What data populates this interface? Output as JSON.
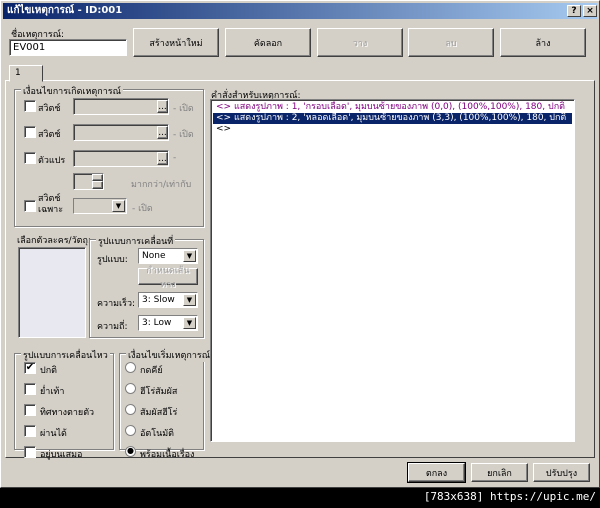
{
  "window": {
    "title": "แก้ไขเหตุการณ์ - ID:001",
    "help": "?",
    "close": "×"
  },
  "event_name": {
    "label": "ชื่อเหตุการณ์:",
    "value": "EV001"
  },
  "toolbar": {
    "new_page": "สร้างหน้าใหม่",
    "copy": "คัดลอก",
    "paste": "วาง",
    "delete": "ลบ",
    "clear": "ล้าง"
  },
  "tabs": [
    "1"
  ],
  "conditions": {
    "title": "เงื่อนไขการเกิดเหตุการณ์",
    "switch1": "สวิตช์",
    "switch2": "สวิตช์",
    "variable": "ตัวแปร",
    "self_switch": "สวิตช์ เฉพาะ",
    "on": "- เปิด",
    "dash": "-",
    "gte": "มากกว่า/เท่ากับ",
    "browse": "..."
  },
  "graphic": {
    "label": "เลือกตัวละคร/วัตถุ:"
  },
  "movement": {
    "title": "รูปแบบการเคลื่อนที่",
    "type_label": "รูปแบบ:",
    "type": "None",
    "route": "กำหนดเส้นทาง",
    "speed_label": "ความเร็ว:",
    "speed": "3: Slow",
    "freq_label": "ความถี่:",
    "freq": "3: Low"
  },
  "options": {
    "title": "รูปแบบการเคลื่อนไหว",
    "items": [
      {
        "label": "ปกติ",
        "checked": true
      },
      {
        "label": "ย่ำเท้า",
        "checked": false
      },
      {
        "label": "ทิศทางตายตัว",
        "checked": false
      },
      {
        "label": "ผ่านได้",
        "checked": false
      },
      {
        "label": "อยู่บนเสมอ",
        "checked": false
      }
    ]
  },
  "trigger": {
    "title": "เงื่อนไขเริ่มเหตุการณ์",
    "items": [
      {
        "label": "กดคีย์",
        "selected": false
      },
      {
        "label": "ฮีโร่สัมผัส",
        "selected": false
      },
      {
        "label": "สัมผัสฮีโร่",
        "selected": false
      },
      {
        "label": "อัตโนมัติ",
        "selected": false
      },
      {
        "label": "พร้อมเนื้อเรื่อง",
        "selected": true
      }
    ]
  },
  "commands": {
    "label": "คำสั่งสำหรับเหตุการณ์:",
    "lines": [
      "<> แสดงรูปภาพ : 1, 'กรอบเลือด', มุมบนซ้ายของภาพ (0,0), (100%,100%), 180, ปกติ",
      "<> แสดงรูปภาพ : 2, 'หลอดเลือด', มุมบนซ้ายของภาพ (3,3), (100%,100%), 180, ปกติ",
      "<>"
    ],
    "selected_index": 1
  },
  "footer": {
    "ok": "ตกลง",
    "cancel": "ยกเลิก",
    "apply": "ปรับปรุง"
  },
  "watermark": "[783x638] https://upic.me/"
}
